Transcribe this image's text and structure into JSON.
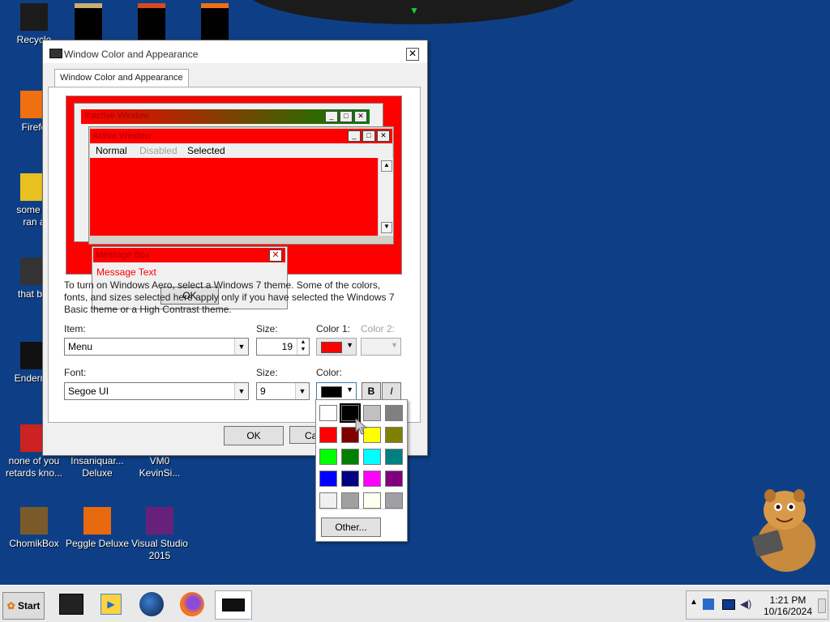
{
  "desktop": {
    "icons": [
      {
        "label": "Recycle",
        "name": "desktop-icon-recycle-bin"
      },
      {
        "label": "Firefo",
        "name": "desktop-icon-firefox"
      },
      {
        "label": "some ru\nran a",
        "name": "desktop-icon-folder-1"
      },
      {
        "label": "that but",
        "name": "desktop-icon-folder-2"
      },
      {
        "label": "Enderma",
        "name": "desktop-icon-enderman"
      },
      {
        "label": "none of you\nretards kno...",
        "name": "desktop-icon-none-of-you"
      },
      {
        "label": "Insaniquar...\nDeluxe",
        "name": "desktop-icon-insaniquarium"
      },
      {
        "label": "VM0\nKevinSi...",
        "name": "desktop-icon-vm0"
      },
      {
        "label": "ChomikBox",
        "name": "desktop-icon-chomikbox"
      },
      {
        "label": "Peggle Deluxe",
        "name": "desktop-icon-peggle"
      },
      {
        "label": "Visual Studio\n2015",
        "name": "desktop-icon-visual-studio"
      }
    ]
  },
  "window": {
    "title": "Window Color and Appearance",
    "close_label": "✕",
    "tab_label": "Window Color and Appearance",
    "preview": {
      "inactive_title": "Inactive Window",
      "active_title": "Active Window",
      "menu": {
        "normal": "Normal",
        "disabled": "Disabled",
        "selected": "Selected"
      },
      "msg_title": "Message Box",
      "msg_text": "Message Text",
      "msg_ok": "OK"
    },
    "description": "To turn on Windows Aero, select a Windows 7 theme.  Some of the colors, fonts, and sizes selected here apply only if you have selected the Windows 7 Basic theme or a High Contrast theme.",
    "item_label": "Item:",
    "item_value": "Menu",
    "size_label": "Size:",
    "size_value": "19",
    "color1_label": "Color 1:",
    "color2_label": "Color 2:",
    "color1_value": "#ff0000",
    "font_label": "Font:",
    "font_value": "Segoe UI",
    "font_size_label": "Size:",
    "font_size_value": "9",
    "font_color_label": "Color:",
    "font_color_value": "#000000",
    "bold_label": "B",
    "italic_label": "I",
    "ok_label": "OK",
    "cancel_label": "Ca"
  },
  "palette": {
    "colors": [
      "#ffffff",
      "#000000",
      "#c0c0c0",
      "#808080",
      "#ff0000",
      "#800000",
      "#ffff00",
      "#808000",
      "#00ff00",
      "#008000",
      "#00ffff",
      "#008080",
      "#0000ff",
      "#000080",
      "#ff00ff",
      "#800080",
      "#f0f0f0",
      "#a0a0a0",
      "#fffff0",
      "#a0a0a4"
    ],
    "selected_index": 1,
    "other_label": "Other..."
  },
  "taskbar": {
    "start_label": "Start",
    "time": "1:21 PM",
    "date": "10/16/2024"
  }
}
